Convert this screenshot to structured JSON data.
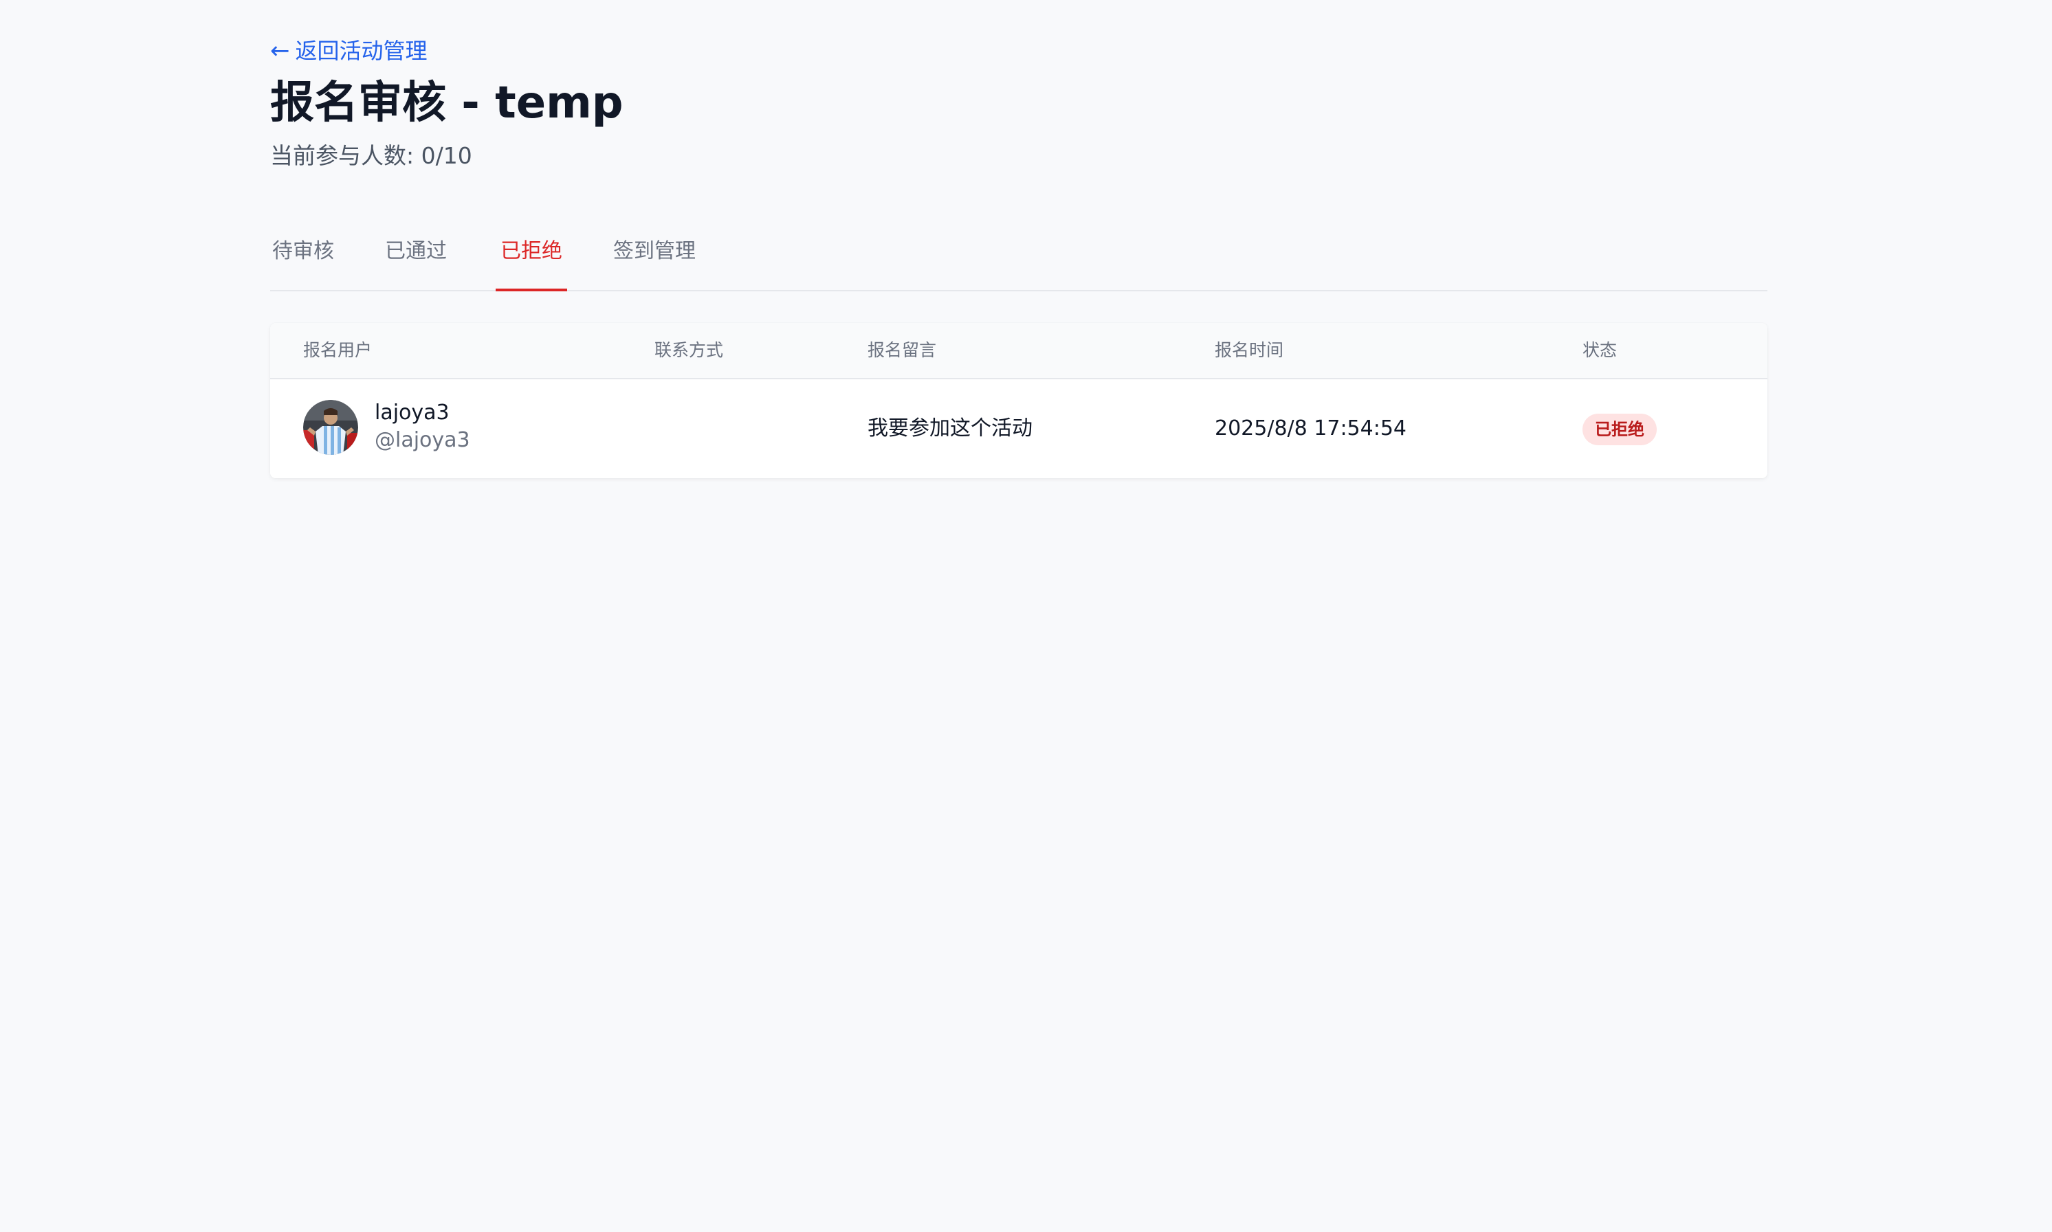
{
  "nav": {
    "back_arrow": "←",
    "back_label": "返回活动管理"
  },
  "header": {
    "title": "报名审核 - temp",
    "participants": "当前参与人数: 0/10"
  },
  "tabs": [
    {
      "label": "待审核",
      "active": false
    },
    {
      "label": "已通过",
      "active": false
    },
    {
      "label": "已拒绝",
      "active": true
    },
    {
      "label": "签到管理",
      "active": false
    }
  ],
  "table": {
    "columns": [
      "报名用户",
      "联系方式",
      "报名留言",
      "报名时间",
      "状态"
    ],
    "rows": [
      {
        "user_name": "lajoya3",
        "user_handle": "@lajoya3",
        "contact": "",
        "message": "我要参加这个活动",
        "time": "2025/8/8 17:54:54",
        "status": "已拒绝"
      }
    ]
  },
  "colors": {
    "accent_link": "#2563eb",
    "active_tab": "#dc2626",
    "status_rejected_bg": "#fee2e2",
    "status_rejected_text": "#b91c1c",
    "page_bg": "#f8f9fb"
  }
}
